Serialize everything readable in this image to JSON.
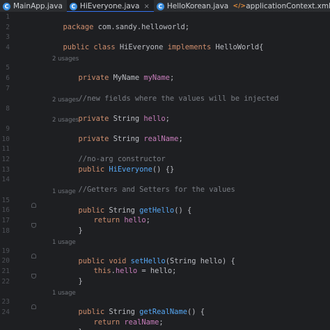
{
  "tabs": [
    {
      "label": "MainApp.java",
      "icon": "java-class-icon",
      "active": false
    },
    {
      "label": "HiEveryone.java",
      "icon": "java-class-icon",
      "active": true
    },
    {
      "label": "HelloKorean.java",
      "icon": "java-class-icon",
      "active": false
    },
    {
      "label": "applicationContext.xml",
      "icon": "xml-file-icon",
      "active": false
    }
  ],
  "tab_icon_glyph": "C",
  "xml_icon_glyph": "</>",
  "close_glyph": "×",
  "colors": {
    "keyword": "#cf8e6d",
    "method": "#56a8f5",
    "field": "#c77dbb",
    "comment": "#7a7e85",
    "text": "#bcbec4",
    "background": "#1e1f22",
    "accent": "#3574f0"
  },
  "editor": {
    "line_numbers": [
      "1",
      "2",
      "3",
      "4",
      "5",
      "6",
      "7",
      "8",
      "9",
      "10",
      "11",
      "12",
      "13",
      "14",
      "15",
      "16",
      "17",
      "18",
      "19",
      "20",
      "21",
      "22",
      "23",
      "24"
    ],
    "usage_hints": [
      "2 usages",
      "2 usages",
      "2 usages",
      "1 usage",
      "1 usage",
      "1 usage"
    ],
    "lines": {
      "l1": {
        "kw": "package",
        "rest": " com.sandy.helloworld;"
      },
      "l3": {
        "kw1": "public class",
        "name": " HiEveryone ",
        "kw2": "implements",
        "rest": " HelloWorld{"
      },
      "l5": {
        "kw": "private",
        "type": " MyName ",
        "field": "myName",
        "rest": ";"
      },
      "l7": {
        "comment": "//new fields where the values will be injected"
      },
      "l8": {
        "kw": "private",
        "type": " String ",
        "field": "hello",
        "rest": ";"
      },
      "l9": {
        "kw": "private",
        "type": " String ",
        "field": "realName",
        "rest": ";"
      },
      "l11": {
        "comment": "//no-arg constructor"
      },
      "l12": {
        "kw": "public",
        "method": " HiEveryone",
        "rest": "() {}"
      },
      "l14": {
        "comment": "//Getters and Setters for the values"
      },
      "l15": {
        "kw": "public",
        "type": " String ",
        "method": "getHello",
        "rest": "() {"
      },
      "l16": {
        "kw": "return",
        "field": " hello",
        "rest": ";"
      },
      "l17": {
        "rest": "}"
      },
      "l19": {
        "kw1": "public",
        "kw2": " void ",
        "method": "setHello",
        "rest": "(String hello) {"
      },
      "l20": {
        "kw": "this",
        "dot": ".",
        "field": "hello",
        "rest": " = hello;"
      },
      "l21": {
        "rest": "}"
      },
      "l23": {
        "kw": "public",
        "type": " String ",
        "method": "getRealName",
        "rest": "() {"
      },
      "l24": {
        "kw": "return",
        "field": " realName",
        "rest": ";"
      },
      "l25": {
        "rest": "}"
      }
    }
  }
}
